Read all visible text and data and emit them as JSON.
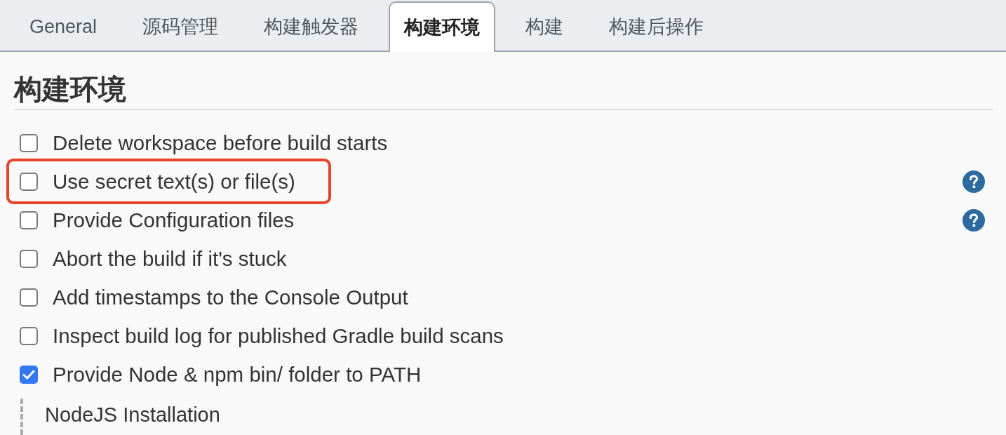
{
  "tabs": [
    {
      "label": "General",
      "selected": false
    },
    {
      "label": "源码管理",
      "selected": false
    },
    {
      "label": "构建触发器",
      "selected": false
    },
    {
      "label": "构建环境",
      "selected": true
    },
    {
      "label": "构建",
      "selected": false
    },
    {
      "label": "构建后操作",
      "selected": false
    }
  ],
  "section": {
    "title": "构建环境"
  },
  "options": [
    {
      "label": "Delete workspace before build starts",
      "checked": false,
      "help": false,
      "highlighted": false
    },
    {
      "label": "Use secret text(s) or file(s)",
      "checked": false,
      "help": true,
      "highlighted": true
    },
    {
      "label": "Provide Configuration files",
      "checked": false,
      "help": true,
      "highlighted": false
    },
    {
      "label": "Abort the build if it's stuck",
      "checked": false,
      "help": false,
      "highlighted": false
    },
    {
      "label": "Add timestamps to the Console Output",
      "checked": false,
      "help": false,
      "highlighted": false
    },
    {
      "label": "Inspect build log for published Gradle build scans",
      "checked": false,
      "help": false,
      "highlighted": false
    },
    {
      "label": "Provide Node & npm bin/ folder to PATH",
      "checked": true,
      "help": false,
      "highlighted": false
    }
  ],
  "subsection": {
    "label": "NodeJS Installation"
  }
}
